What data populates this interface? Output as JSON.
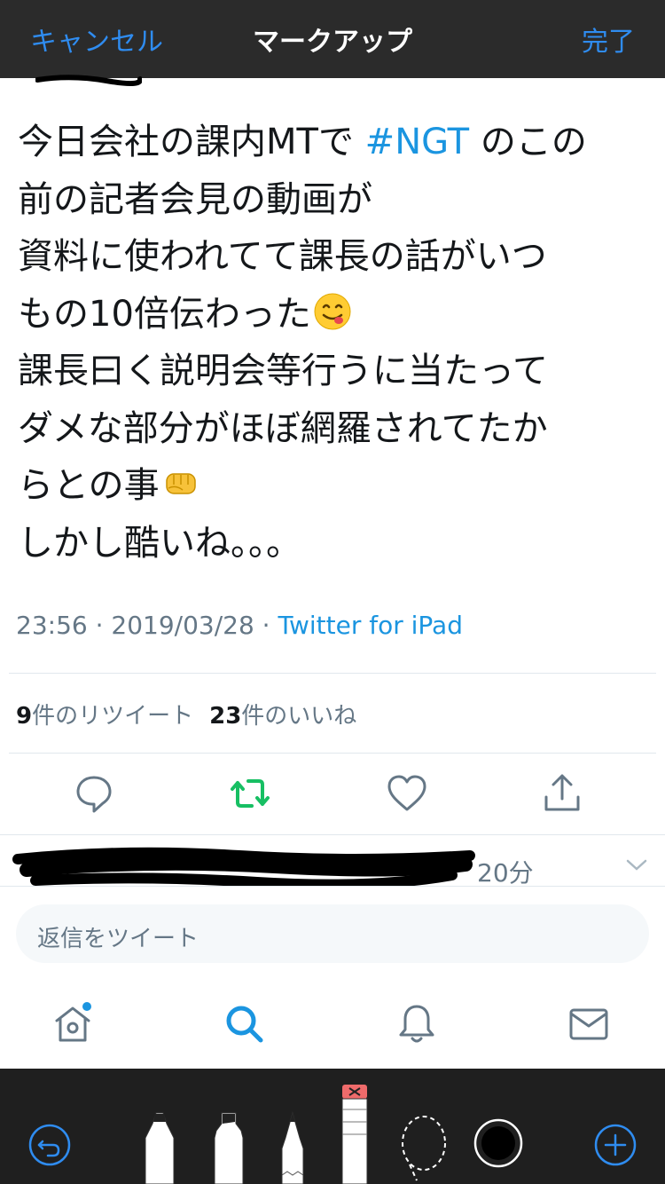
{
  "markup_bar": {
    "cancel_label": "キャンセル",
    "title": "マークアップ",
    "done_label": "完了"
  },
  "tweet": {
    "lines": [
      {
        "before": "今日会社の課内MTで ",
        "hashtag": "#NGT",
        "after": " のこの"
      },
      {
        "text": "前の記者会見の動画が"
      },
      {
        "text": "資料に使われてて課長の話がいつ"
      },
      {
        "text": "もの10倍伝わった",
        "emoji": "face-savoring-food"
      },
      {
        "text": "課長曰く説明会等行うに当たって"
      },
      {
        "text": "ダメな部分がほぼ網羅されてたか"
      },
      {
        "text": "らとの事",
        "emoji": "oncoming-fist"
      },
      {
        "text": "しかし酷いね。。。"
      }
    ],
    "timestamp": "23:56 · 2019/03/28 · ",
    "via": "Twitter for iPad"
  },
  "stats": {
    "retweets_count": "9",
    "retweets_label": "件のリツイート",
    "likes_count": "23",
    "likes_label": "件のいいね"
  },
  "actions": {
    "reply_icon": "reply-icon",
    "retweet_icon": "retweet-icon",
    "like_icon": "heart-icon",
    "share_icon": "share-icon"
  },
  "reply_row": {
    "time": "20分"
  },
  "compose": {
    "placeholder": "返信をツイート"
  },
  "tabbar": {
    "tabs": [
      "home-icon",
      "search-icon",
      "notifications-icon",
      "messages-icon"
    ]
  },
  "colors": {
    "accent": "#1b95e0",
    "retweet_green": "#17bf63",
    "markup_blue": "#2f8cf0",
    "toolbar_bg": "#1f1f1f",
    "topbar_bg": "#2b2b2b"
  }
}
